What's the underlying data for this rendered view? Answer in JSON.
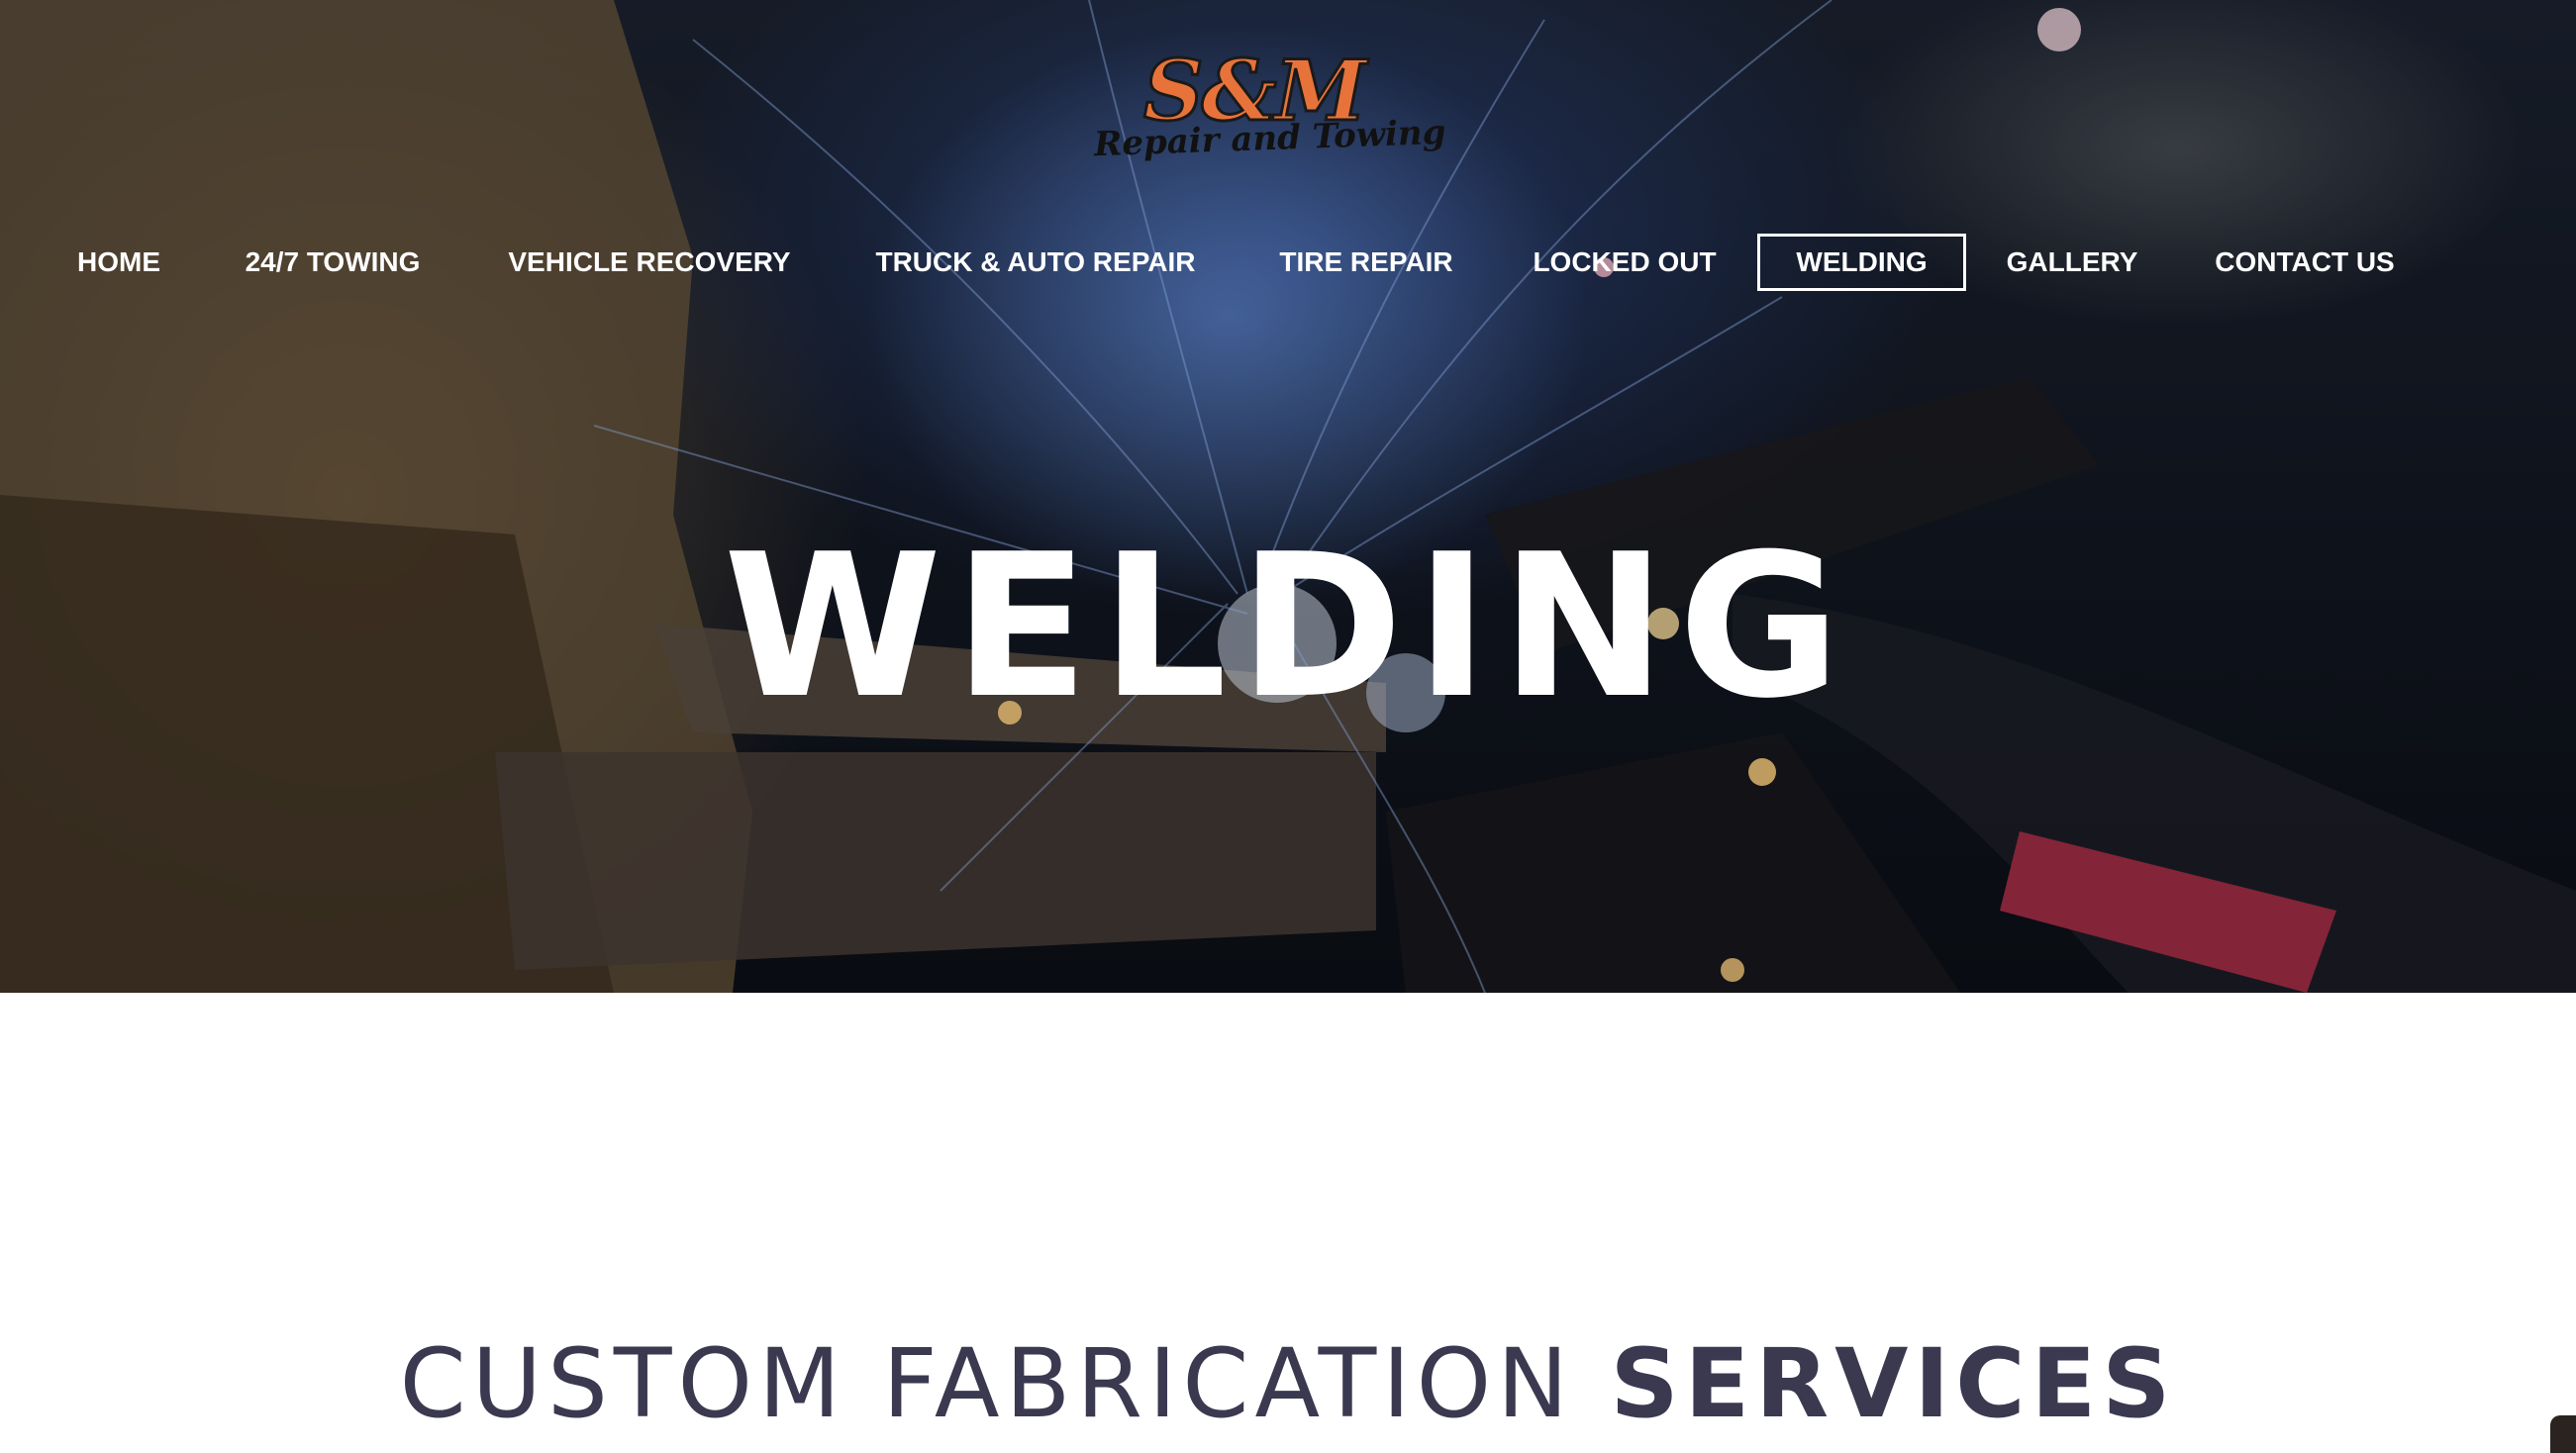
{
  "logo": {
    "main_text": "S&M",
    "sub_text": "Repair and Towing"
  },
  "nav": {
    "items": [
      {
        "label": "HOME"
      },
      {
        "label": "24/7 TOWING"
      },
      {
        "label": "VEHICLE RECOVERY"
      },
      {
        "label": "TRUCK & AUTO REPAIR"
      },
      {
        "label": "TIRE REPAIR"
      },
      {
        "label": "LOCKED OUT"
      },
      {
        "label": "WELDING"
      },
      {
        "label": "GALLERY"
      },
      {
        "label": "CONTACT US"
      }
    ],
    "active": "WELDING"
  },
  "hero": {
    "title": "WELDING"
  },
  "section": {
    "heading_light": "CUSTOM FABRICATION ",
    "heading_bold": "SERVICES"
  },
  "colors": {
    "logo_orange": "#e8733a",
    "heading_text": "#3a3950",
    "nav_text": "#ffffff"
  }
}
